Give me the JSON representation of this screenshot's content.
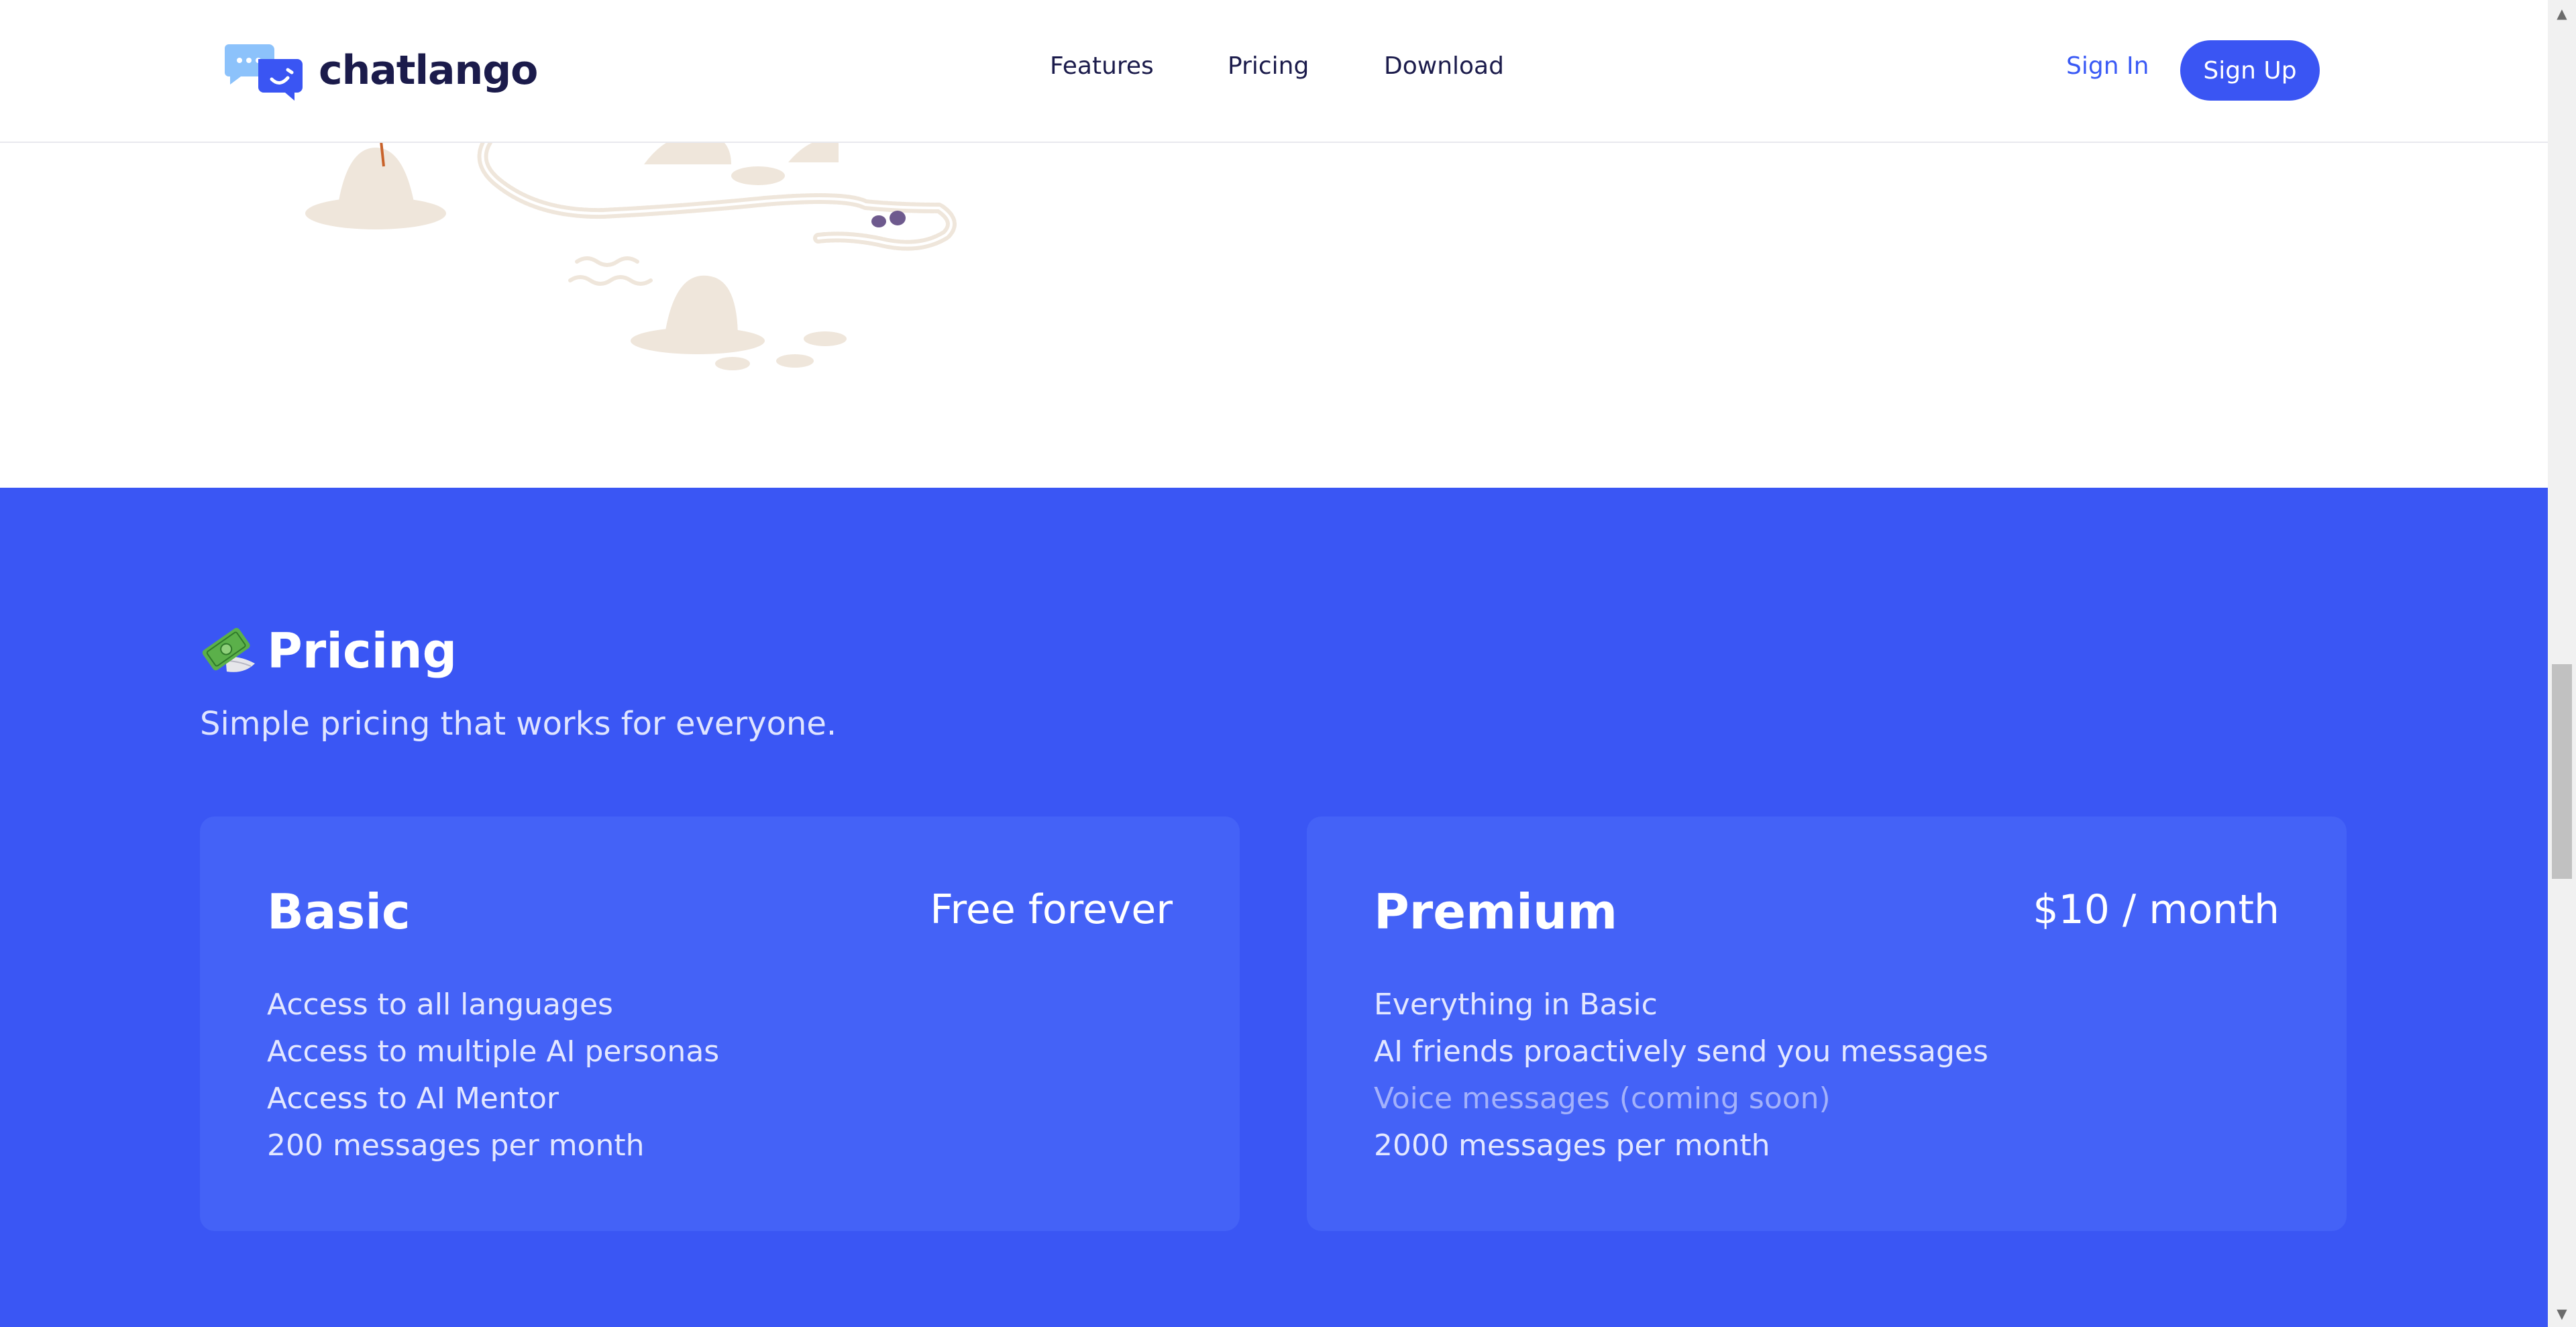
{
  "header": {
    "logo_text": "chatlango",
    "nav": {
      "features": "Features",
      "pricing": "Pricing",
      "download": "Download"
    },
    "sign_in": "Sign In",
    "sign_up": "Sign Up"
  },
  "pricing": {
    "icon": "money-with-wings-icon",
    "title": "Pricing",
    "subtitle": "Simple pricing that works for everyone.",
    "plans": [
      {
        "name": "Basic",
        "price": "Free forever",
        "features": [
          "Access to all languages",
          "Access to multiple AI personas",
          "Access to AI Mentor",
          "200 messages per month"
        ]
      },
      {
        "name": "Premium",
        "price": "$10 / month",
        "features": [
          "Everything in Basic",
          "AI friends proactively send you messages",
          "Voice messages (coming soon)",
          "2000 messages per month"
        ],
        "muted_feature": "Voice messages (coming soon)"
      }
    ]
  },
  "colors": {
    "brand_blue": "#3a56f4",
    "card_blue": "#4462f7",
    "button_blue": "#3a55f3",
    "navy_text": "#1b1b4b",
    "logo_light_blue": "#8cc2fb"
  }
}
